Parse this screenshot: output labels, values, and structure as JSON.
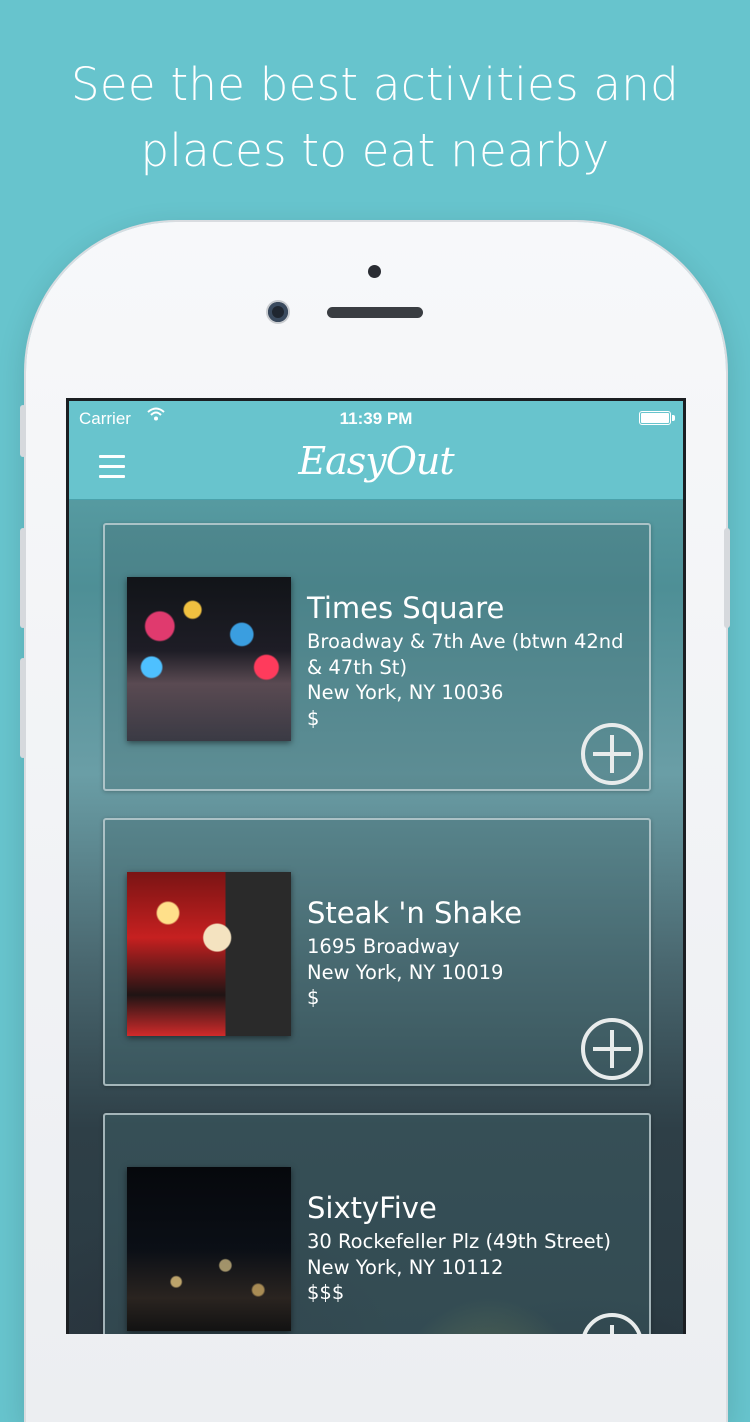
{
  "headline": {
    "line1": "See the best activities and",
    "line2": "places to eat nearby"
  },
  "status_bar": {
    "carrier": "Carrier",
    "time": "11:39 PM"
  },
  "nav": {
    "app_title": "EasyOut"
  },
  "places": [
    {
      "name": "Times Square",
      "address": "Broadway & 7th Ave (btwn 42nd & 47th St)",
      "city": "New York, NY 10036",
      "price": "$"
    },
    {
      "name": "Steak 'n Shake",
      "address": "1695 Broadway",
      "city": "New York, NY 10019",
      "price": "$"
    },
    {
      "name": "SixtyFive",
      "address": "30 Rockefeller Plz (49th Street)",
      "city": "New York, NY 10112",
      "price": "$$$"
    }
  ],
  "colors": {
    "background": "#67c4cd",
    "nav_bar": "#68c4cd",
    "text": "#ffffff"
  }
}
